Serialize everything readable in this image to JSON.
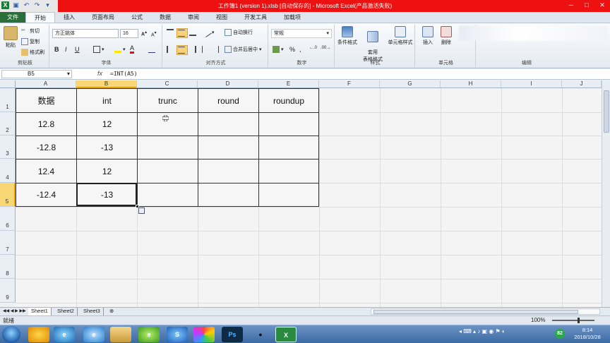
{
  "window": {
    "title": "工作簿1 (version 1).xlsb [自动保存的] - Microsoft Excel(产品激活失败)"
  },
  "ribbon_tabs": [
    "文件",
    "开始",
    "插入",
    "页面布局",
    "公式",
    "数据",
    "审阅",
    "视图",
    "开发工具",
    "加载项"
  ],
  "ribbon": {
    "clipboard": {
      "cut": "剪切",
      "copy": "复制",
      "format_painter": "格式刷",
      "paste": "粘贴",
      "label": "剪贴板"
    },
    "font": {
      "name": "方正姚体",
      "size": "16",
      "label": "字体",
      "bold": "B",
      "italic": "I",
      "underline": "U",
      "font_color": "A",
      "grow": "A",
      "shrink": "A"
    },
    "alignment": {
      "wrap": "自动换行",
      "merge": "合并后居中",
      "label": "对齐方式"
    },
    "number": {
      "format": "常规",
      "label": "数字",
      "percent": "%",
      "comma": ","
    },
    "styles": {
      "conditional": "条件格式",
      "table": "套用\n表格格式",
      "cell_styles": "单元格样式",
      "label": "样式"
    },
    "cells": {
      "insert": "插入",
      "delete": "删除",
      "label": "单元格"
    },
    "editing": {
      "label": "编辑"
    }
  },
  "formula_bar": {
    "name_box": "B5",
    "fx": "fx",
    "formula": "=INT(A5)"
  },
  "columns": [
    "A",
    "B",
    "C",
    "D",
    "E",
    "F",
    "G",
    "H",
    "I",
    "J"
  ],
  "rows": [
    "1",
    "2",
    "3",
    "4",
    "5",
    "6",
    "7",
    "8",
    "9"
  ],
  "table": {
    "headers": [
      "数据",
      "int",
      "trunc",
      "round",
      "roundup"
    ],
    "rows": [
      [
        "12.8",
        "12",
        "",
        "",
        ""
      ],
      [
        "-12.8",
        "-13",
        "",
        "",
        ""
      ],
      [
        "12.4",
        "12",
        "",
        "",
        ""
      ],
      [
        "-12.4",
        "-13",
        "",
        "",
        ""
      ]
    ]
  },
  "sheets": [
    "Sheet1",
    "Sheet2",
    "Sheet3"
  ],
  "status": {
    "ready": "就绪",
    "zoom": "100%"
  },
  "taskbar": {
    "time": "8:14",
    "date": "2018/10/28",
    "badge": "82"
  }
}
